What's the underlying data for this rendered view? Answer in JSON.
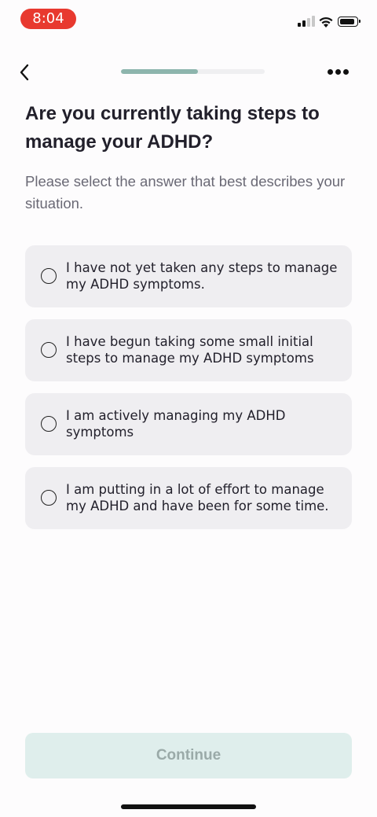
{
  "status_bar": {
    "time": "8:04"
  },
  "header": {
    "progress_fraction": 0.535
  },
  "question": {
    "title": "Are you currently taking steps to manage your ADHD?",
    "subtitle": "Please select the answer that best describes your situation."
  },
  "options": [
    {
      "label": "I have not yet taken any steps to manage my ADHD symptoms."
    },
    {
      "label": "I have begun taking some small initial steps to manage my ADHD symptoms"
    },
    {
      "label": "I am actively managing my ADHD symptoms"
    },
    {
      "label": "I am putting in a lot of effort to manage my ADHD and have been for some time."
    }
  ],
  "footer": {
    "continue_label": "Continue"
  },
  "colors": {
    "accent_progress": "#8db5ad",
    "time_pill": "#e8392f",
    "continue_bg_disabled": "#dfeeec"
  }
}
